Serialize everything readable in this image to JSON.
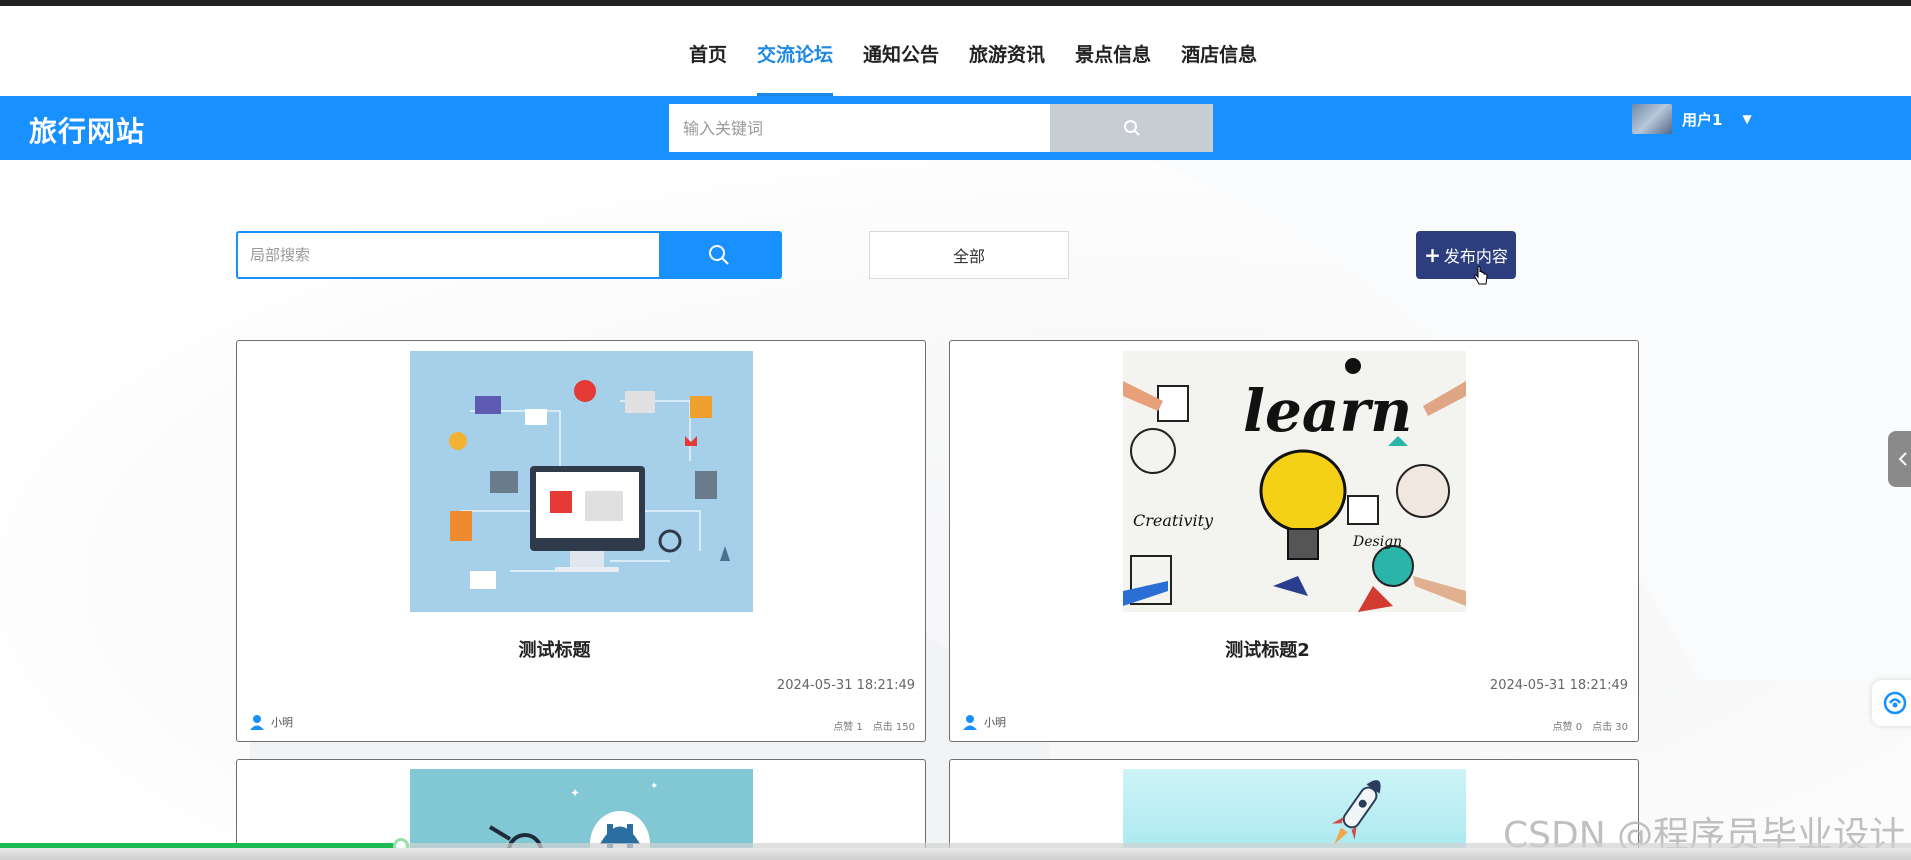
{
  "nav": {
    "items": [
      {
        "label": "首页",
        "active": false
      },
      {
        "label": "交流论坛",
        "active": true
      },
      {
        "label": "通知公告",
        "active": false
      },
      {
        "label": "旅游资讯",
        "active": false
      },
      {
        "label": "景点信息",
        "active": false
      },
      {
        "label": "酒店信息",
        "active": false
      }
    ]
  },
  "header": {
    "logo": "旅行网站",
    "search_placeholder": "输入关键词",
    "user_name": "用户1",
    "background_color": "#1890ff"
  },
  "filters": {
    "search_placeholder": "局部搜索",
    "all_label": "全部",
    "publish_label": "发布内容",
    "publish_color": "#2c3e7e"
  },
  "cards": [
    {
      "title": "测试标题",
      "date": "2024-05-31 18:21:49",
      "author": "小明",
      "likes": "点赞 1",
      "clicks": "点击 150"
    },
    {
      "title": "测试标题2",
      "date": "2024-05-31 18:21:49",
      "author": "小明",
      "likes": "点赞 0",
      "clicks": "点击 30"
    }
  ],
  "video_progress": 0.21,
  "watermark": "CSDN @程序员毕业设计"
}
